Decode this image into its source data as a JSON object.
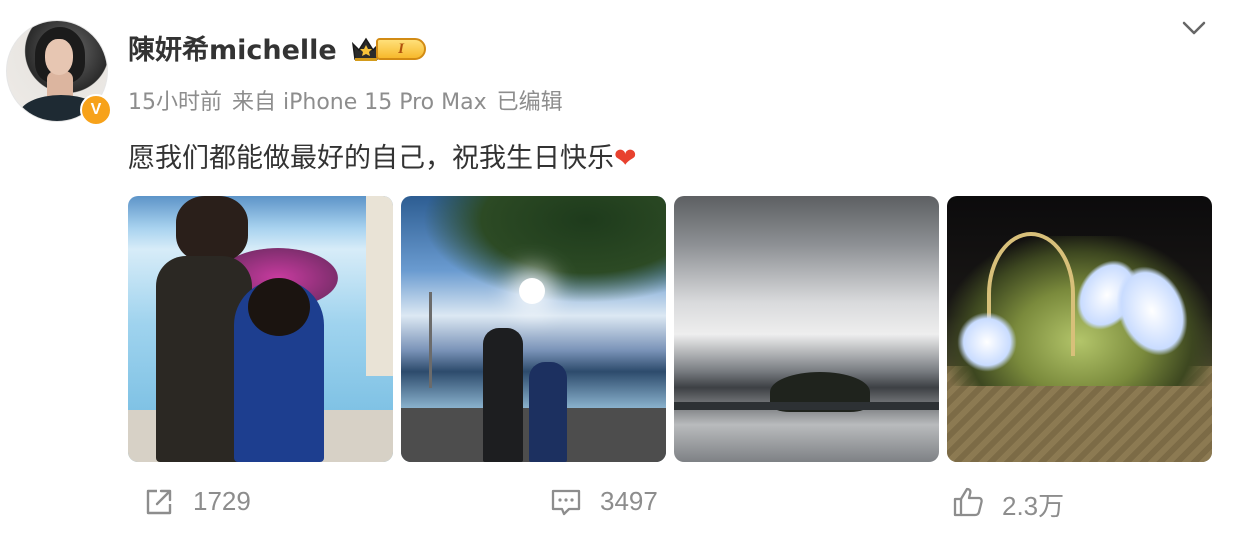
{
  "post": {
    "author": {
      "name": "陳妍希michelle",
      "verified_mark": "V",
      "level_badge": "I"
    },
    "meta": {
      "time": "15小时前",
      "source": "来自 iPhone 15 Pro Max",
      "edited": "已编辑"
    },
    "text": "愿我们都能做最好的自己，祝我生日快乐",
    "emoji": "❤",
    "photos": [
      "photo-1",
      "photo-2",
      "photo-3",
      "photo-4"
    ]
  },
  "actions": {
    "share_count": "1729",
    "comment_count": "3497",
    "like_count": "2.3万"
  },
  "colors": {
    "text": "#333333",
    "meta": "#8d8d8d",
    "verified": "#f7a21a",
    "heart": "#e8412e"
  },
  "icons": {
    "menu": "chevron-down-icon",
    "share": "share-icon",
    "comment": "comment-icon",
    "like": "thumbs-up-icon"
  }
}
